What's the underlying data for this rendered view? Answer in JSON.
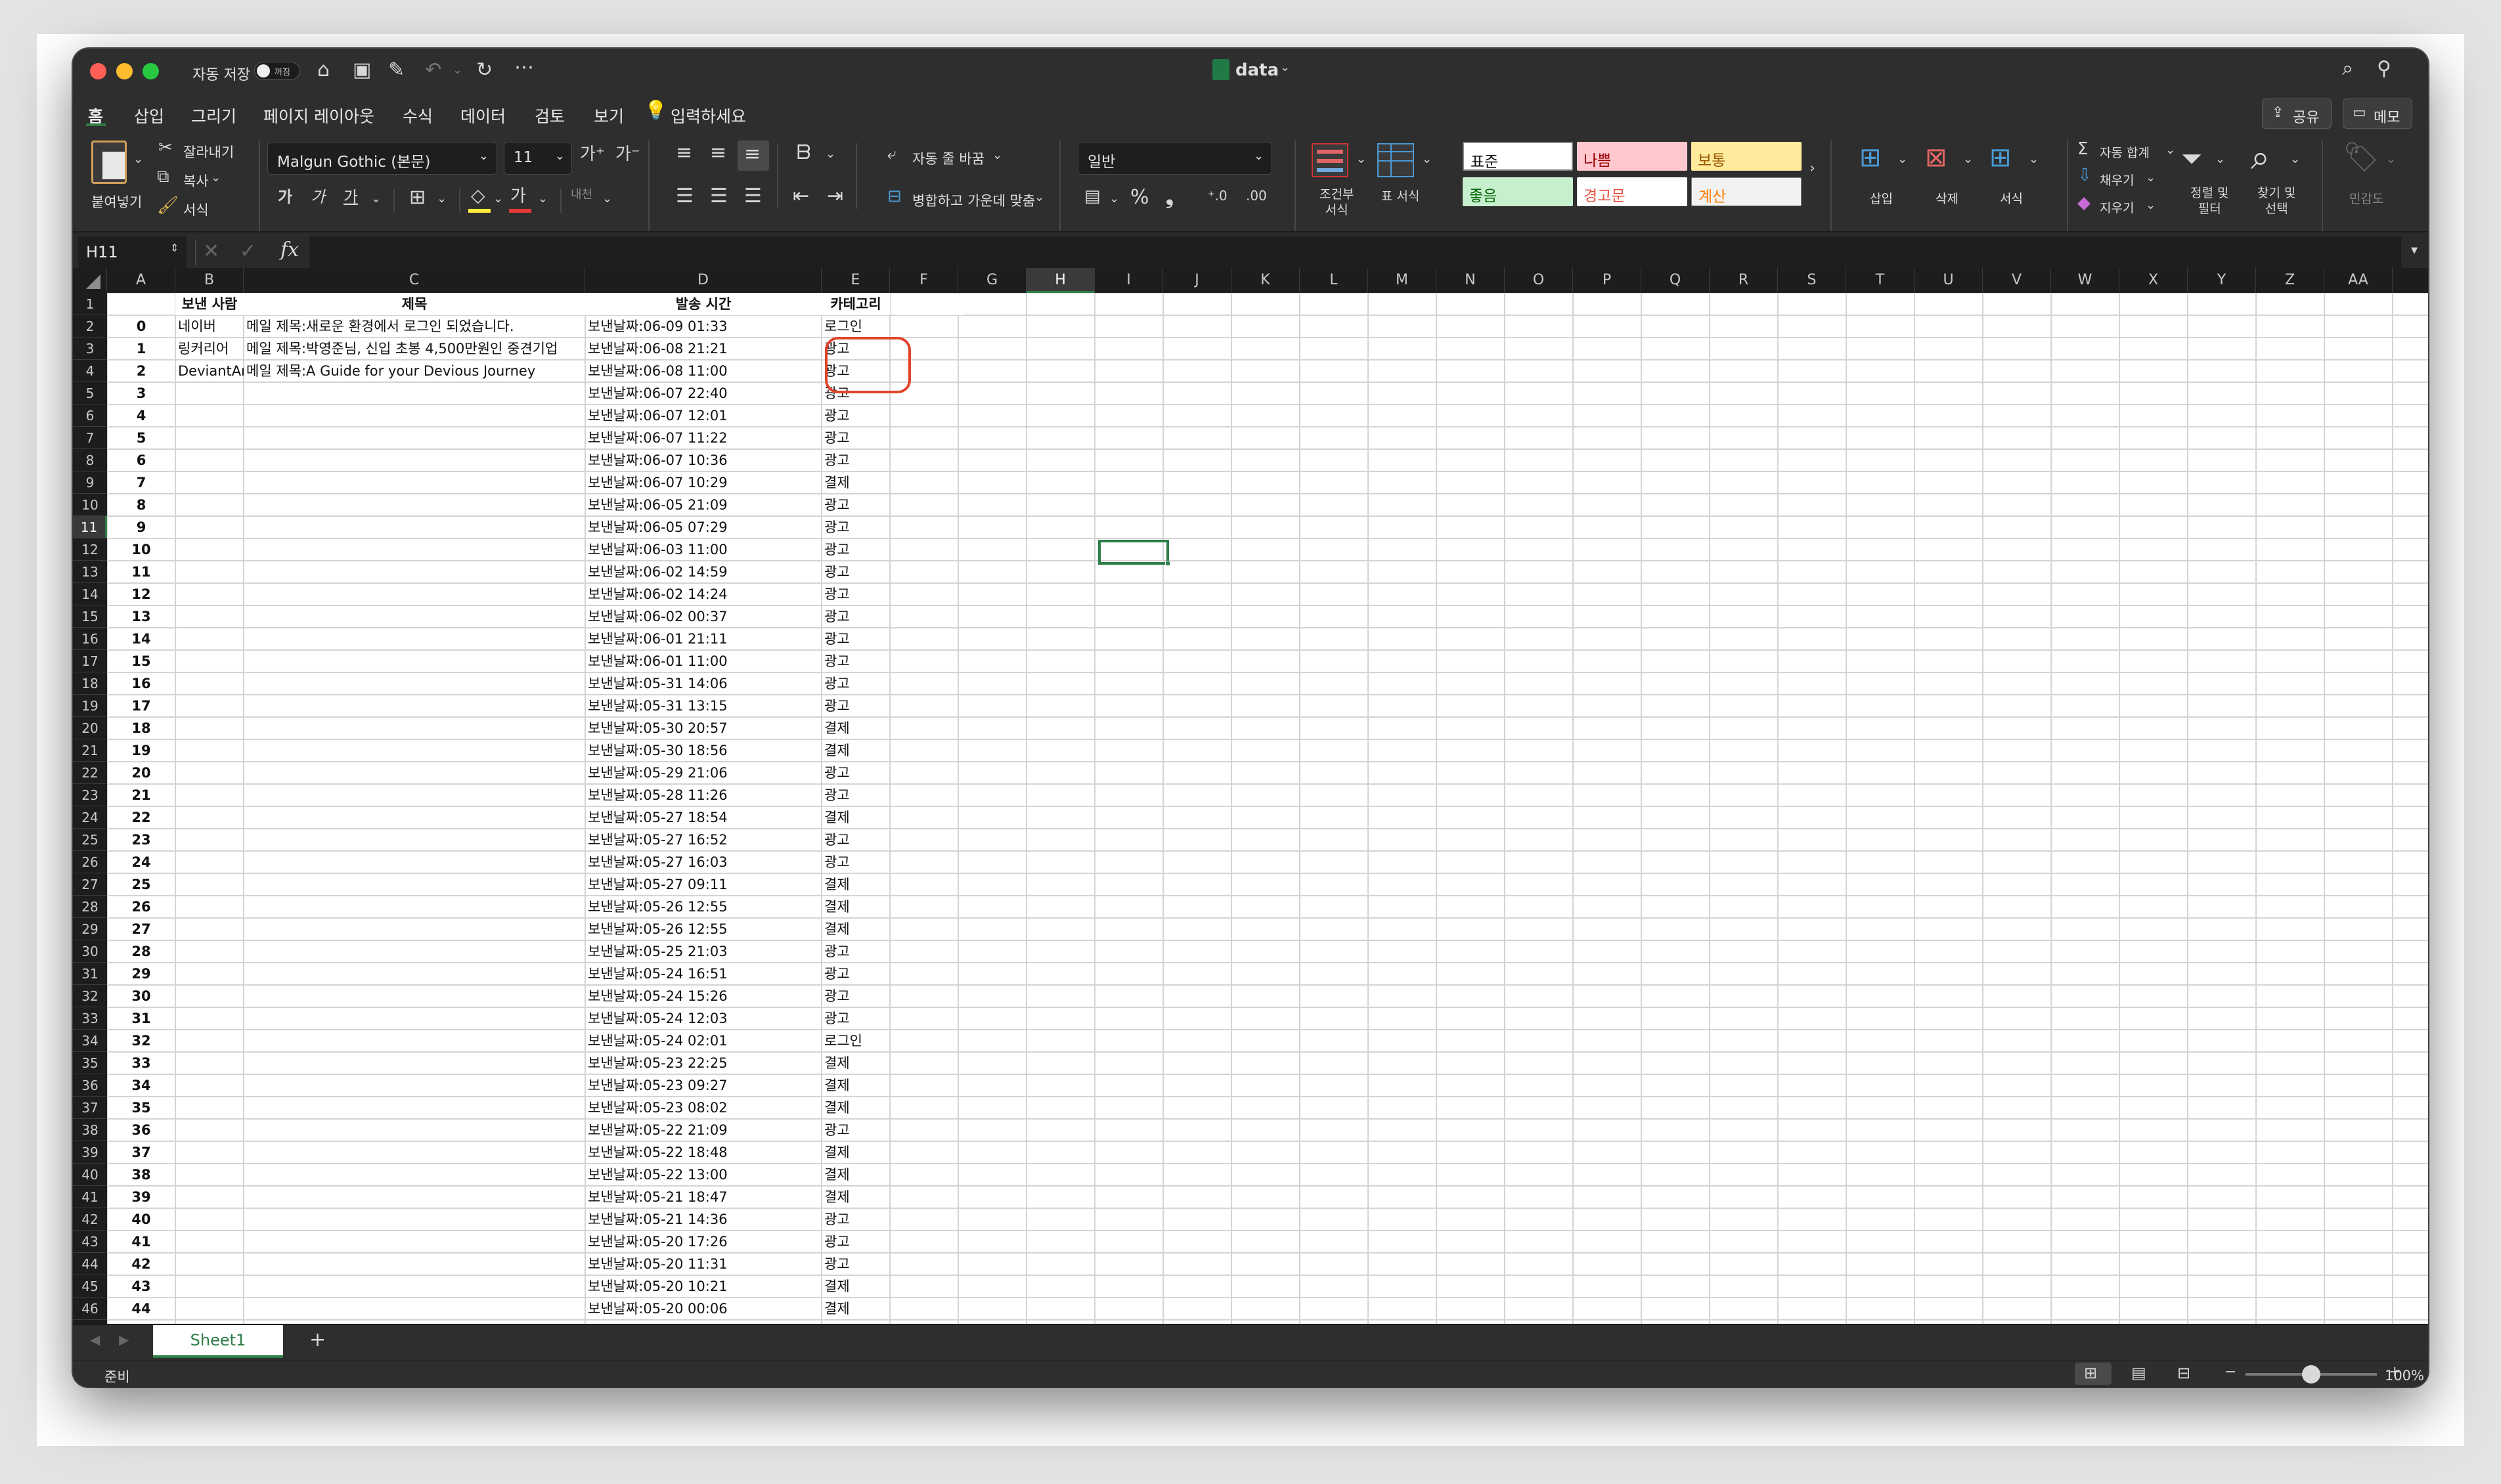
{
  "window": {
    "title": "data",
    "autosave_label": "자동 저장",
    "autosave_state": "꺼짐"
  },
  "ribbon_tabs": [
    "홈",
    "삽입",
    "그리기",
    "페이지 레이아웃",
    "수식",
    "데이터",
    "검토",
    "보기"
  ],
  "tell_me": "입력하세요",
  "share_label": "공유",
  "comments_label": "메모",
  "clipboard": {
    "paste": "붙여넣기",
    "cut": "잘라내기",
    "copy": "복사",
    "format": "서식"
  },
  "font": {
    "name": "Malgun Gothic (본문)",
    "size": "11"
  },
  "alignment": {
    "wrap": "자동 줄 바꿈",
    "merge": "병합하고 가운데 맞춤"
  },
  "number_format": "일반",
  "conditional_format": "조건부\n서식",
  "format_as_table": "표 서식",
  "styles": {
    "normal": "표준",
    "bad": "나쁨",
    "neutral": "보통",
    "good": "좋음",
    "warning": "경고문",
    "calc": "계산"
  },
  "cells_group": {
    "insert": "삽입",
    "delete": "삭제",
    "format": "서식"
  },
  "editing": {
    "autosum": "자동 합계",
    "fill": "채우기",
    "clear": "지우기",
    "sort": "정렬 및\n필터",
    "find": "찾기 및\n선택"
  },
  "sensitivity": "민감도",
  "name_box": "H11",
  "fx": "fx",
  "columns": [
    "A",
    "B",
    "C",
    "D",
    "E",
    "F",
    "G",
    "H",
    "I",
    "J",
    "K",
    "L",
    "M",
    "N",
    "O",
    "P",
    "Q",
    "R",
    "S",
    "T",
    "U",
    "V",
    "W",
    "X",
    "Y",
    "Z",
    "AA"
  ],
  "row_numbers": [
    "1",
    "2",
    "3",
    "4",
    "5",
    "6",
    "7",
    "8",
    "9",
    "10",
    "11",
    "12",
    "13",
    "14",
    "15",
    "16",
    "17",
    "18",
    "19",
    "20",
    "21",
    "22",
    "23",
    "24",
    "25",
    "26",
    "27",
    "28",
    "29",
    "30",
    "31",
    "32",
    "33",
    "34",
    "35",
    "36",
    "37",
    "38",
    "39",
    "40",
    "41",
    "42",
    "43",
    "44",
    "45",
    "46"
  ],
  "table_headers": {
    "B": "보낸 사람",
    "C": "제목",
    "D": "발송 시간",
    "E": "카테고리"
  },
  "rows": [
    {
      "a": "0",
      "b": "네이버",
      "c": "메일 제목:새로운 환경에서 로그인 되었습니다.",
      "d": "보낸날짜:06-09 01:33",
      "e": "로그인"
    },
    {
      "a": "1",
      "b": "링커리어",
      "c": "메일 제목:박영준님, 신입 초봉 4,500만원인 중견기업",
      "d": "보낸날짜:06-08 21:21",
      "e": "광고"
    },
    {
      "a": "2",
      "b": "DeviantAr",
      "c": "메일 제목:A Guide for your Devious Journey",
      "d": "보낸날짜:06-08 11:00",
      "e": "광고"
    },
    {
      "a": "3",
      "b": "",
      "c": "",
      "d": "보낸날짜:06-07 22:40",
      "e": "광고"
    },
    {
      "a": "4",
      "b": "",
      "c": "",
      "d": "보낸날짜:06-07 12:01",
      "e": "광고"
    },
    {
      "a": "5",
      "b": "",
      "c": "",
      "d": "보낸날짜:06-07 11:22",
      "e": "광고"
    },
    {
      "a": "6",
      "b": "",
      "c": "",
      "d": "보낸날짜:06-07 10:36",
      "e": "광고"
    },
    {
      "a": "7",
      "b": "",
      "c": "",
      "d": "보낸날짜:06-07 10:29",
      "e": "결제"
    },
    {
      "a": "8",
      "b": "",
      "c": "",
      "d": "보낸날짜:06-05 21:09",
      "e": "광고"
    },
    {
      "a": "9",
      "b": "",
      "c": "",
      "d": "보낸날짜:06-05 07:29",
      "e": "광고"
    },
    {
      "a": "10",
      "b": "",
      "c": "",
      "d": "보낸날짜:06-03 11:00",
      "e": "광고"
    },
    {
      "a": "11",
      "b": "",
      "c": "",
      "d": "보낸날짜:06-02 14:59",
      "e": "광고"
    },
    {
      "a": "12",
      "b": "",
      "c": "",
      "d": "보낸날짜:06-02 14:24",
      "e": "광고"
    },
    {
      "a": "13",
      "b": "",
      "c": "",
      "d": "보낸날짜:06-02 00:37",
      "e": "광고"
    },
    {
      "a": "14",
      "b": "",
      "c": "",
      "d": "보낸날짜:06-01 21:11",
      "e": "광고"
    },
    {
      "a": "15",
      "b": "",
      "c": "",
      "d": "보낸날짜:06-01 11:00",
      "e": "광고"
    },
    {
      "a": "16",
      "b": "",
      "c": "",
      "d": "보낸날짜:05-31 14:06",
      "e": "광고"
    },
    {
      "a": "17",
      "b": "",
      "c": "",
      "d": "보낸날짜:05-31 13:15",
      "e": "광고"
    },
    {
      "a": "18",
      "b": "",
      "c": "",
      "d": "보낸날짜:05-30 20:57",
      "e": "결제"
    },
    {
      "a": "19",
      "b": "",
      "c": "",
      "d": "보낸날짜:05-30 18:56",
      "e": "결제"
    },
    {
      "a": "20",
      "b": "",
      "c": "",
      "d": "보낸날짜:05-29 21:06",
      "e": "광고"
    },
    {
      "a": "21",
      "b": "",
      "c": "",
      "d": "보낸날짜:05-28 11:26",
      "e": "광고"
    },
    {
      "a": "22",
      "b": "",
      "c": "",
      "d": "보낸날짜:05-27 18:54",
      "e": "결제"
    },
    {
      "a": "23",
      "b": "",
      "c": "",
      "d": "보낸날짜:05-27 16:52",
      "e": "광고"
    },
    {
      "a": "24",
      "b": "",
      "c": "",
      "d": "보낸날짜:05-27 16:03",
      "e": "광고"
    },
    {
      "a": "25",
      "b": "",
      "c": "",
      "d": "보낸날짜:05-27 09:11",
      "e": "결제"
    },
    {
      "a": "26",
      "b": "",
      "c": "",
      "d": "보낸날짜:05-26 12:55",
      "e": "결제"
    },
    {
      "a": "27",
      "b": "",
      "c": "",
      "d": "보낸날짜:05-26 12:55",
      "e": "결제"
    },
    {
      "a": "28",
      "b": "",
      "c": "",
      "d": "보낸날짜:05-25 21:03",
      "e": "광고"
    },
    {
      "a": "29",
      "b": "",
      "c": "",
      "d": "보낸날짜:05-24 16:51",
      "e": "광고"
    },
    {
      "a": "30",
      "b": "",
      "c": "",
      "d": "보낸날짜:05-24 15:26",
      "e": "광고"
    },
    {
      "a": "31",
      "b": "",
      "c": "",
      "d": "보낸날짜:05-24 12:03",
      "e": "광고"
    },
    {
      "a": "32",
      "b": "",
      "c": "",
      "d": "보낸날짜:05-24 02:01",
      "e": "로그인"
    },
    {
      "a": "33",
      "b": "",
      "c": "",
      "d": "보낸날짜:05-23 22:25",
      "e": "결제"
    },
    {
      "a": "34",
      "b": "",
      "c": "",
      "d": "보낸날짜:05-23 09:27",
      "e": "결제"
    },
    {
      "a": "35",
      "b": "",
      "c": "",
      "d": "보낸날짜:05-23 08:02",
      "e": "결제"
    },
    {
      "a": "36",
      "b": "",
      "c": "",
      "d": "보낸날짜:05-22 21:09",
      "e": "광고"
    },
    {
      "a": "37",
      "b": "",
      "c": "",
      "d": "보낸날짜:05-22 18:48",
      "e": "결제"
    },
    {
      "a": "38",
      "b": "",
      "c": "",
      "d": "보낸날짜:05-22 13:00",
      "e": "결제"
    },
    {
      "a": "39",
      "b": "",
      "c": "",
      "d": "보낸날짜:05-21 18:47",
      "e": "결제"
    },
    {
      "a": "40",
      "b": "",
      "c": "",
      "d": "보낸날짜:05-21 14:36",
      "e": "광고"
    },
    {
      "a": "41",
      "b": "",
      "c": "",
      "d": "보낸날짜:05-20 17:26",
      "e": "광고"
    },
    {
      "a": "42",
      "b": "",
      "c": "",
      "d": "보낸날짜:05-20 11:31",
      "e": "광고"
    },
    {
      "a": "43",
      "b": "",
      "c": "",
      "d": "보낸날짜:05-20 10:21",
      "e": "결제"
    },
    {
      "a": "44",
      "b": "",
      "c": "",
      "d": "보낸날짜:05-20 00:06",
      "e": "결제"
    }
  ],
  "sheet_tab": "Sheet1",
  "status": {
    "ready": "준비",
    "zoom": "100%",
    "zoom_level": 0.5
  },
  "colors": {
    "accent": "#217346",
    "selection": "#2d7d46",
    "annotation": "#e0442a"
  }
}
